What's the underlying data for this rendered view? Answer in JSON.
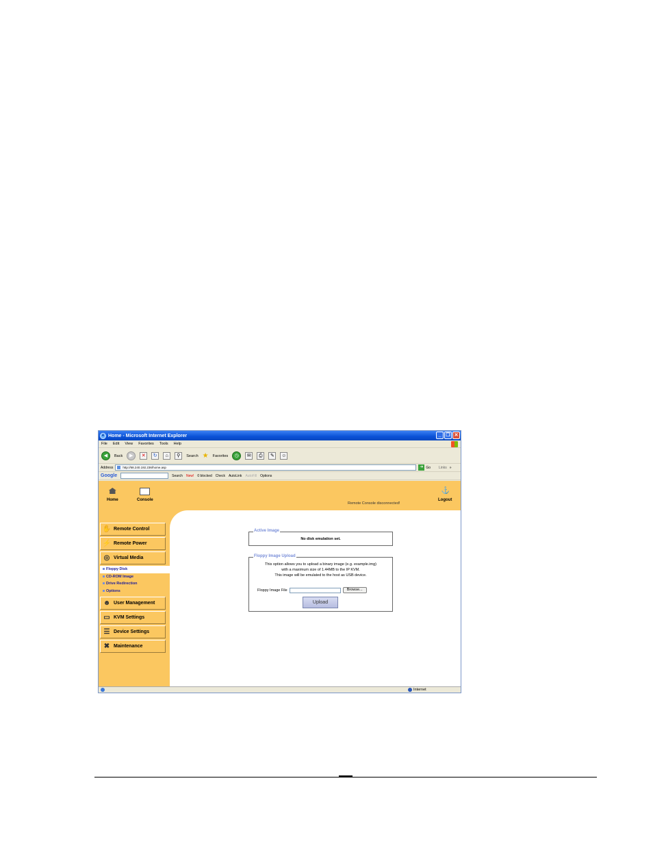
{
  "window": {
    "title": "Home - Microsoft Internet Explorer",
    "min": "_",
    "max": "❐",
    "close": "✕"
  },
  "menubar": [
    "File",
    "Edit",
    "View",
    "Favorites",
    "Tools",
    "Help"
  ],
  "toolbar": {
    "back": "Back",
    "search": "Search",
    "favorites": "Favorites"
  },
  "address": {
    "label": "Address",
    "url": "http://68.240.192.236/home.asp",
    "go": "Go",
    "links": "Links",
    "chevron": "»"
  },
  "google": {
    "logo": "Google",
    "search": "Search",
    "new": "New!",
    "blocked": "0 blocked",
    "check": "Check",
    "autolink": "AutoLink",
    "autofill": "AutoFill",
    "options": "Options"
  },
  "header": {
    "home": "Home",
    "console": "Console",
    "logout": "Logout",
    "status": "Remote Console disconnected!"
  },
  "menu": {
    "remote_control": "Remote Control",
    "remote_power": "Remote Power",
    "virtual_media": "Virtual Media",
    "submenu": [
      "Floppy Disk",
      "CD-ROM Image",
      "Drive Redirection",
      "Options"
    ],
    "user_management": "User Management",
    "kvm_settings": "KVM Settings",
    "device_settings": "Device Settings",
    "maintenance": "Maintenance"
  },
  "active_image": {
    "legend": "Active Image",
    "text": "No disk emulation set."
  },
  "floppy_upload": {
    "legend": "Floppy Image Upload",
    "line1": "This option allows you to upload a binary image (e.g. example.img)",
    "line2": "with a maximum size of 1.44MB to the IP KVM.",
    "line3": "This image will be emulated to the host as USB device.",
    "file_label": "Floppy Image File",
    "browse": "Browse...",
    "upload": "Upload"
  },
  "statusbar": {
    "zone": "Internet"
  }
}
